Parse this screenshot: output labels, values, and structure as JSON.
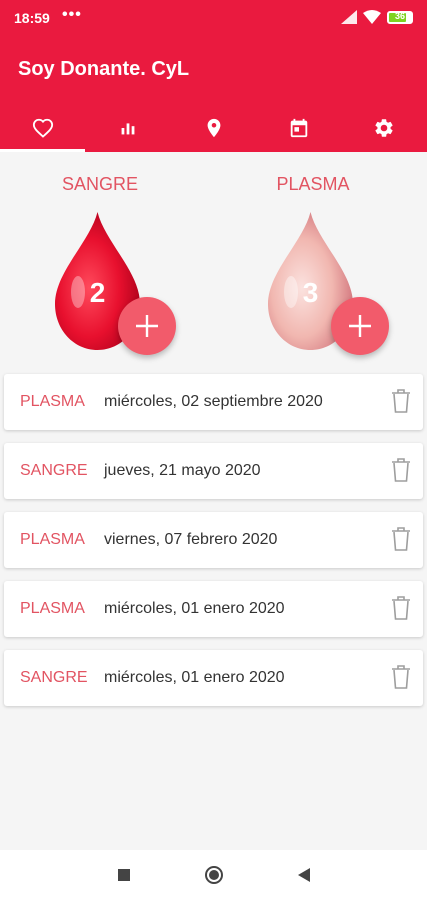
{
  "status_bar": {
    "time": "18:59",
    "dots": "•••",
    "battery": "36"
  },
  "app_bar": {
    "title": "Soy Donante. CyL"
  },
  "tabs": [
    {
      "id": "donations",
      "icon": "heart-icon",
      "active": true
    },
    {
      "id": "stats",
      "icon": "bar-chart-icon",
      "active": false
    },
    {
      "id": "locations",
      "icon": "map-pin-icon",
      "active": false
    },
    {
      "id": "calendar",
      "icon": "calendar-icon",
      "active": false
    },
    {
      "id": "settings",
      "icon": "gear-icon",
      "active": false
    }
  ],
  "summary": {
    "sangre": {
      "label": "SANGRE",
      "count": "2"
    },
    "plasma": {
      "label": "PLASMA",
      "count": "3"
    }
  },
  "donations": [
    {
      "type": "PLASMA",
      "date": "miércoles, 02 septiembre 2020"
    },
    {
      "type": "SANGRE",
      "date": "jueves, 21 mayo 2020"
    },
    {
      "type": "PLASMA",
      "date": "viernes, 07 febrero 2020"
    },
    {
      "type": "PLASMA",
      "date": "miércoles, 01 enero 2020"
    },
    {
      "type": "SANGRE",
      "date": "miércoles, 01 enero 2020"
    }
  ],
  "colors": {
    "primary": "#ea1a3f",
    "accent": "#f25b6b",
    "label": "#e25462"
  }
}
